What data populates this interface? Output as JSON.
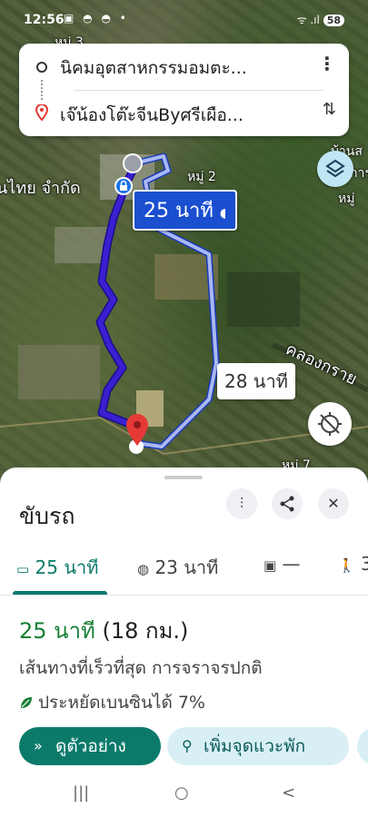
{
  "status": {
    "time": "12:56",
    "icons": "▣ ◓ ◓ •",
    "signal": "ᯤ .ıl",
    "battery": "58"
  },
  "search": {
    "origin": "นิคมอุตสาหกรรมอมตะ...",
    "destination": "เจ๊น้องโต๊ะจีนByศรีเผือ...",
    "more_icon": "⋮",
    "swap_icon": "⇅"
  },
  "map": {
    "labels": {
      "company": "นไทย จำกัด",
      "moo2": "หมู่ 2",
      "moo3": "หมู่ 3",
      "moo7": "หมู่ 7",
      "right_top": "บ้านส",
      "right_top2": "การ",
      "right_mid": "หมู่",
      "river": "คลองกราย"
    },
    "route_time_primary": "25 นาที",
    "route_time_alt": "28 นาที",
    "route_color": "#3b1fd0"
  },
  "sheet": {
    "mode_title": "ขับรถ",
    "filter_icon": "⫶",
    "share_icon": "<",
    "close_icon": "✕",
    "tabs": [
      {
        "icon": "▭",
        "label": "25 นาที"
      },
      {
        "icon": "◍",
        "label": "23 นาที"
      },
      {
        "icon": "▣",
        "label": "—"
      },
      {
        "icon": "🚶",
        "label": "3"
      }
    ],
    "duration": "25 นาที",
    "distance": "(18 กม.)",
    "description": "เส้นทางที่เร็วที่สุด การจราจรปกติ",
    "eco": "ประหยัดเบนซินได้ 7%",
    "preview_button": "ดูตัวอย่าง",
    "preview_icon": "»",
    "add_stop_button": "เพิ่มจุดแวะพัก",
    "add_stop_icon": "⚲",
    "accent": "#0b7a6b"
  },
  "navbar": {
    "recents": "|||",
    "home": "○",
    "back": "<"
  }
}
